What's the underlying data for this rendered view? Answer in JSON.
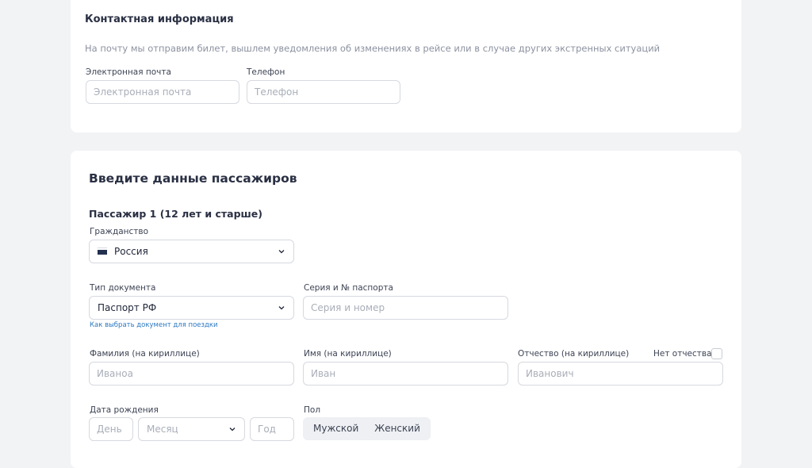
{
  "contact": {
    "title": "Контактная информация",
    "description": "На почту мы отправим билет, вышлем уведомления об изменениях в рейсе или в случае других экстренных ситуаций",
    "email_label": "Электронная почта",
    "email_placeholder": "Электронная почта",
    "phone_label": "Телефон",
    "phone_placeholder": "Телефон"
  },
  "passengers": {
    "title": "Введите данные пассажиров",
    "passenger1": {
      "title": "Пассажир 1 (12 лет и старше)",
      "citizenship_label": "Гражданство",
      "citizenship_value": "Россия",
      "doc_type_label": "Тип документа",
      "doc_type_value": "Паспорт РФ",
      "doc_help_link": "Как выбрать документ для поездки",
      "passport_label": "Серия и № паспорта",
      "passport_placeholder": "Серия и номер",
      "surname_label": "Фамилия (на кириллице)",
      "surname_placeholder": "Иваноа",
      "name_label": "Имя (на кириллице)",
      "name_placeholder": "Иван",
      "patronymic_label": "Отчество (на кириллице)",
      "patronymic_placeholder": "Иванович",
      "no_patronymic_label": "Нет отчества",
      "birth_label": "Дата рождения",
      "day_placeholder": "День",
      "month_placeholder": "Месяц",
      "year_placeholder": "Год",
      "gender_label": "Пол",
      "gender_male": "Мужской",
      "gender_female": "Женский"
    }
  },
  "icons": {
    "flag": "russia-flag-icon",
    "chevron": "chevron-down-icon"
  }
}
